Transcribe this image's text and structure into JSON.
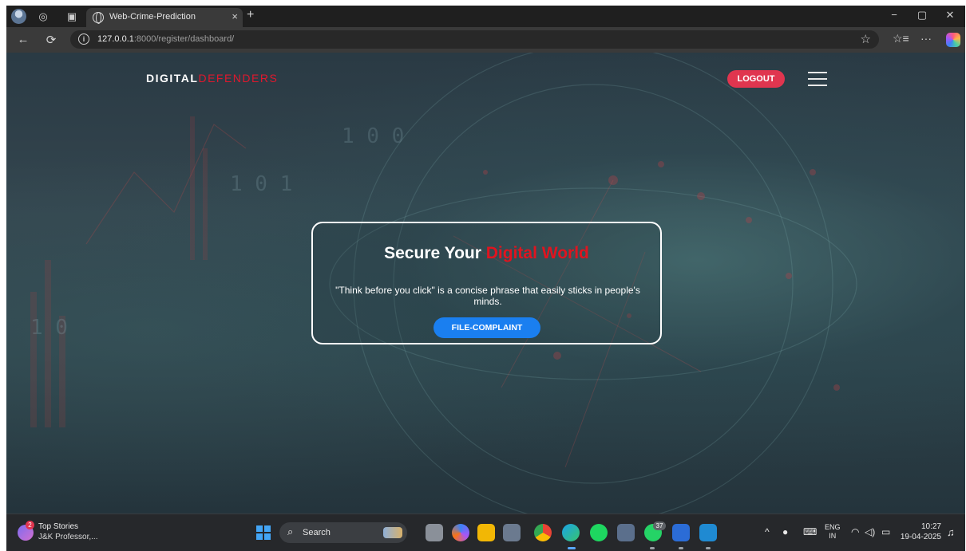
{
  "browser": {
    "tab_title": "Web-Crime-Prediction",
    "tab_close": "×",
    "new_tab": "+",
    "url_host": "127.0.0.1",
    "url_path": ":8000/register/dashboard/",
    "window_controls": {
      "minimize": "−",
      "restore": "▢",
      "close": "✕"
    },
    "nav": {
      "back": "←",
      "refresh": "⟳",
      "more": "···"
    }
  },
  "site": {
    "brand_main": "DIGITAL",
    "brand_accent": "DEFENDERS",
    "logout_label": "LOGOUT",
    "hero_title_main": "Secure Your ",
    "hero_title_accent": "Digital World",
    "hero_text": "\"Think before you click\" is a concise phrase that easily sticks in people's minds.",
    "complaint_label": "FILE-COMPLAINT"
  },
  "taskbar": {
    "news_badge": "2",
    "news_title": "Top Stories",
    "news_subtitle": "J&K Professor,...",
    "search_placeholder": "Search",
    "whatsapp_badge": "37",
    "lang_top": "ENG",
    "lang_bottom": "IN",
    "time": "10:27",
    "date": "19-04-2025"
  },
  "colors": {
    "brand_accent": "#e0182d",
    "logout_bg": "#e0354f",
    "complaint_bg": "#1a7ff0",
    "hero_accent": "#e0141f"
  }
}
